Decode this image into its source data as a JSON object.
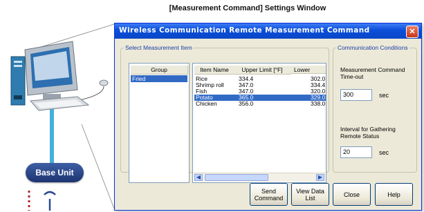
{
  "caption": "[Measurement Command] Settings Window",
  "base_unit_label": "Base Unit",
  "window": {
    "title": "Wireless Communication Remote Measurement Command",
    "close_glyph": "✕"
  },
  "select_item": {
    "legend": "Select Measurement Item",
    "group_header": "Group",
    "groups": [
      "Fried"
    ],
    "selected_group": "Fried",
    "columns": [
      "Item Name",
      "Upper Limit [°F]",
      "Lower"
    ],
    "items": [
      {
        "name": "Rice",
        "upper": "334.4",
        "lower": "302.0",
        "selected": false
      },
      {
        "name": "Shrimp roll",
        "upper": "347.0",
        "lower": "334.4",
        "selected": false
      },
      {
        "name": "Fish",
        "upper": "347.0",
        "lower": "320.0",
        "selected": false
      },
      {
        "name": "Potato",
        "upper": "365.0",
        "lower": "329.0",
        "selected": true
      },
      {
        "name": "Chicken",
        "upper": "356.0",
        "lower": "338.0",
        "selected": false
      }
    ]
  },
  "comm": {
    "legend": "Communication Conditions",
    "timeout_label": "Measurement Command Time-out",
    "timeout_value": "300",
    "timeout_unit": "sec",
    "interval_label": "Interval for Gathering Remote Status",
    "interval_value": "20",
    "interval_unit": "sec"
  },
  "buttons": {
    "send": "Send Command",
    "view": "View Data List",
    "close": "Close",
    "help": "Help"
  },
  "colors": {
    "title_bar": "#0a4ed8",
    "selection": "#316ac5",
    "cable": "#44b0dc",
    "badge": "#2b4a92",
    "dotted_link": "#b3272d"
  },
  "icons": [
    "computer-terminal-illustration",
    "wifi-signal-icon",
    "scroll-left-icon",
    "scroll-right-icon",
    "close-icon"
  ]
}
